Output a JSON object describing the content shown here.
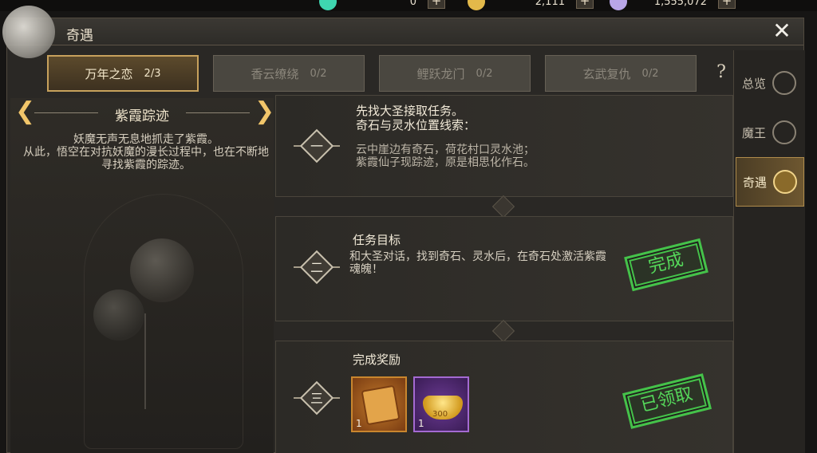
{
  "resources": [
    {
      "name": "jade",
      "value": "0",
      "color": "#3fd6b0"
    },
    {
      "name": "gold",
      "value": "2,111",
      "color": "#e3b94a"
    },
    {
      "name": "silver",
      "value": "1,555,072",
      "color": "#b9a6e8"
    }
  ],
  "window": {
    "title": "奇遇",
    "close": "✕"
  },
  "tabs": [
    {
      "label": "万年之恋",
      "count": "2/3",
      "active": true
    },
    {
      "label": "香云缭绕",
      "count": "0/2",
      "active": false
    },
    {
      "label": "鲤跃龙门",
      "count": "0/2",
      "active": false
    },
    {
      "label": "玄武复仇",
      "count": "0/2",
      "active": false
    }
  ],
  "help": "?",
  "sidenav": [
    {
      "label": "总览",
      "icon": "overview-icon",
      "active": false
    },
    {
      "label": "魔王",
      "icon": "demon-king-icon",
      "active": false
    },
    {
      "label": "奇遇",
      "icon": "encounter-icon",
      "active": true
    }
  ],
  "story": {
    "title": "紫霞踪迹",
    "prev": "❮",
    "next": "❯",
    "text": "妖魔无声无息地抓走了紫霞。\n从此，悟空在对抗妖魔的漫长过程中，也在不断地寻找紫霞的踪迹。"
  },
  "steps": [
    {
      "num": "一",
      "title": "先找大圣接取任务。",
      "subtitle": "奇石与灵水位置线索：",
      "text": "云中崖边有奇石，荷花村口灵水池；\n紫霞仙子现踪迹，原是相思化作石。"
    },
    {
      "num": "二",
      "title": "任务目标",
      "text": "和大圣对话，找到奇石、灵水后，在奇石处激活紫霞魂魄！",
      "stamp": "完成"
    },
    {
      "num": "三",
      "title": "完成奖励",
      "stamp": "已领取",
      "rewards": [
        {
          "name": "scroll-item",
          "count": "1",
          "quality": "orange"
        },
        {
          "name": "gold-ingot-item",
          "count": "1",
          "quality": "purple",
          "label": "300"
        }
      ]
    }
  ]
}
